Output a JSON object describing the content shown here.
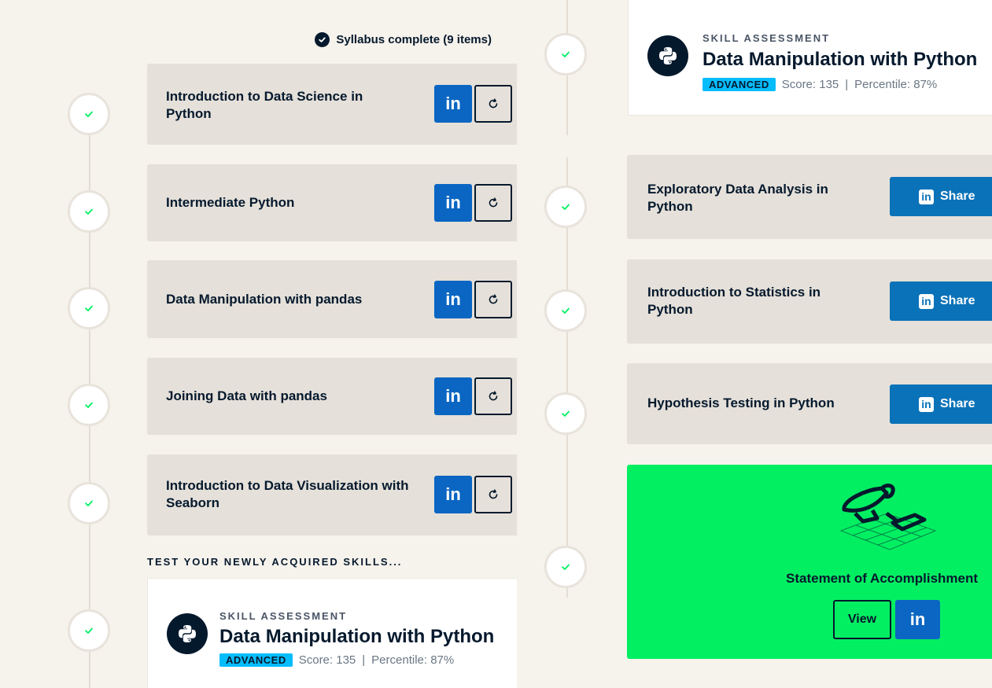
{
  "left": {
    "syllabus_status": "Syllabus complete (9 items)",
    "courses": [
      {
        "title": "Introduction to Data Science in Python"
      },
      {
        "title": "Intermediate Python"
      },
      {
        "title": "Data Manipulation with pandas"
      },
      {
        "title": "Joining Data with pandas"
      },
      {
        "title": "Introduction to Data Visualization with Seaborn"
      }
    ],
    "linkedin_label": "in",
    "section_heading": "TEST YOUR NEWLY ACQUIRED SKILLS...",
    "assessment": {
      "label": "SKILL ASSESSMENT",
      "title": "Data Manipulation with Python",
      "level": "ADVANCED",
      "score": "Score: 135",
      "percentile": "Percentile: 87%"
    }
  },
  "right": {
    "assessment": {
      "label": "SKILL ASSESSMENT",
      "title": "Data Manipulation with Python",
      "level": "ADVANCED",
      "score": "Score: 135",
      "percentile": "Percentile: 87%"
    },
    "courses": [
      {
        "title": "Exploratory Data Analysis in Python",
        "share_label": "Share"
      },
      {
        "title": "Introduction to Statistics in Python",
        "share_label": "Share"
      },
      {
        "title": "Hypothesis Testing in Python",
        "share_label": "Share"
      }
    ],
    "accomplishment": {
      "title": "Statement of Accomplishment",
      "view_label": "View",
      "linkedin_label": "in"
    }
  },
  "separator": "|",
  "colors": {
    "background": "#f6f2ec",
    "card": "#e5e0d9",
    "navy": "#05192d",
    "linkedin": "#0a66c2",
    "green": "#03ef62",
    "check": "#03ef62",
    "badge_blue": "#06bdfc"
  }
}
